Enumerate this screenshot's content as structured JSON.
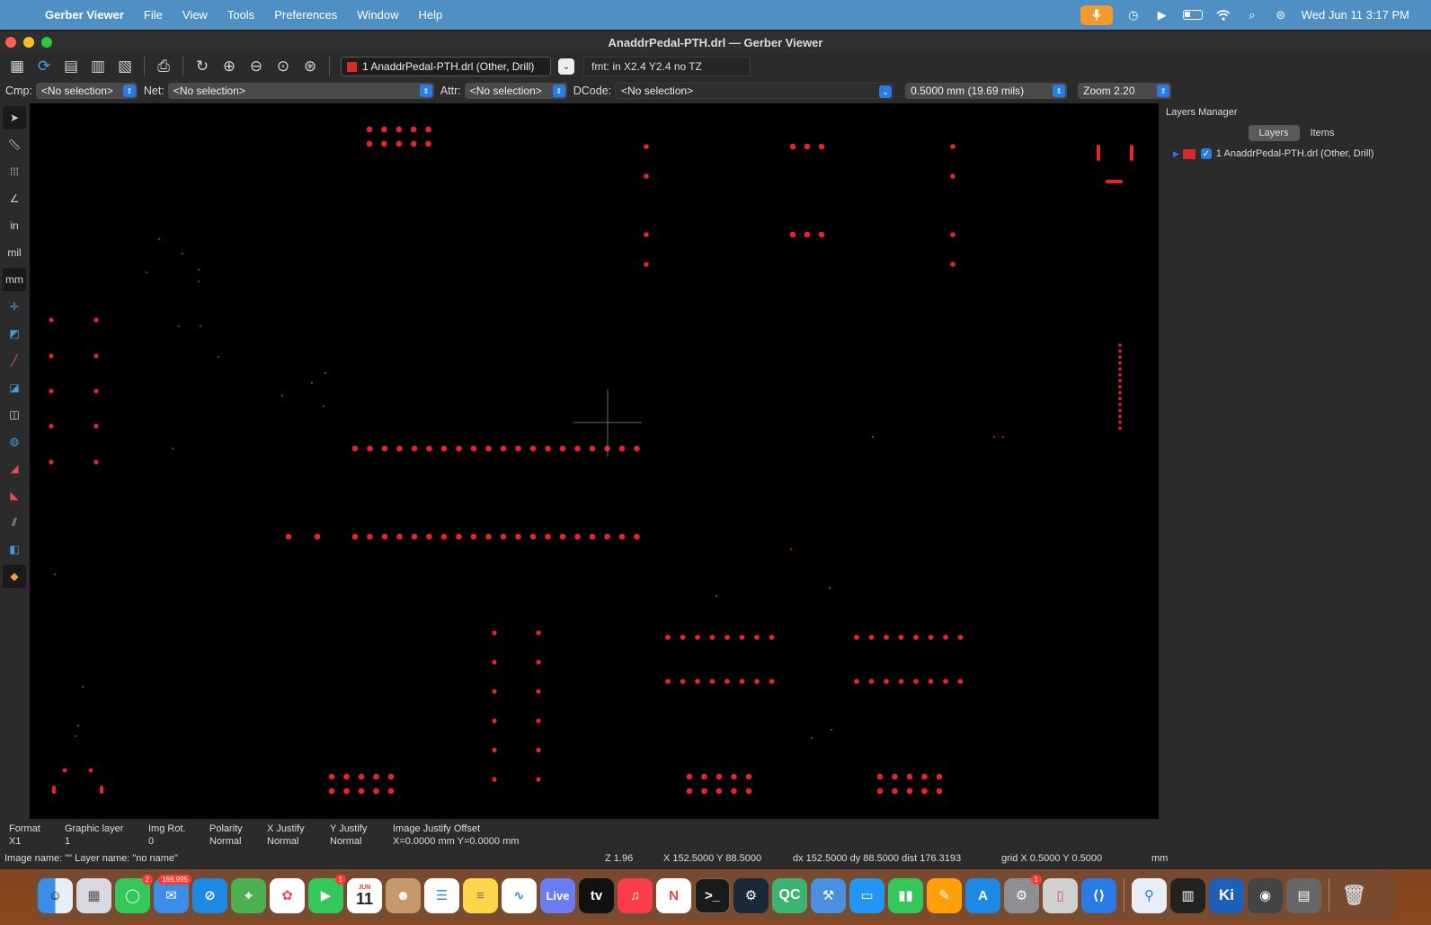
{
  "menubar": {
    "app_name": "Gerber Viewer",
    "items": [
      "File",
      "View",
      "Tools",
      "Preferences",
      "Window",
      "Help"
    ],
    "clock": "Wed Jun 11  3:17 PM"
  },
  "window": {
    "title": "AnaddrPedal-PTH.drl — Gerber Viewer"
  },
  "toolbar": {
    "layer_select": "1 AnaddrPedal-PTH.drl (Other, Drill)",
    "fmt": "fmt: in X2.4 Y2.4 no TZ"
  },
  "selectors": {
    "cmp_label": "Cmp:",
    "cmp_value": "<No selection>",
    "net_label": "Net:",
    "net_value": "<No selection>",
    "attr_label": "Attr:",
    "attr_value": "<No selection>",
    "dcode_label": "DCode:",
    "dcode_value": "<No selection>",
    "grid_value": "0.5000 mm (19.69 mils)",
    "zoom_value": "Zoom 2.20"
  },
  "left_tools": [
    "select",
    "measure",
    "grid",
    "polar",
    "in",
    "mil",
    "mm",
    "cursor",
    "layer-a",
    "layer-b",
    "layer-c",
    "layer-d",
    "layer-e",
    "layer-f",
    "layer-g",
    "layer-h",
    "layer-i",
    "layers"
  ],
  "left_tool_texts": {
    "in": "in",
    "mil": "mil",
    "mm": "mm"
  },
  "layers_manager": {
    "title": "Layers Manager",
    "tabs": [
      "Layers",
      "Items"
    ],
    "active_tab": "Layers",
    "layer_name": "1 AnaddrPedal-PTH.drl (Other, Drill)",
    "layer_color": "#d62b2b"
  },
  "status": {
    "format_label": "Format",
    "format_value": "X1",
    "graphic_layer_label": "Graphic layer",
    "graphic_layer_value": "1",
    "img_rot_label": "Img Rot.",
    "img_rot_value": "0",
    "polarity_label": "Polarity",
    "polarity_value": "Normal",
    "xjustify_label": "X Justify",
    "xjustify_value": "Normal",
    "yjustify_label": "Y Justify",
    "yjustify_value": "Normal",
    "offset_label": "Image Justify Offset",
    "offset_value": "X=0.0000 mm Y=0.0000 mm",
    "image_name": "Image name: \"\"  Layer name: \"no name\"",
    "zoom": "Z 1.96",
    "coords": "X 152.5000  Y 88.5000",
    "delta": "dx 152.5000  dy 88.5000  dist 176.3193",
    "grid": "grid X 0.5000  Y 0.5000",
    "units": "mm"
  },
  "dock": {
    "messages_badge": "2",
    "mail_badge": "169,995",
    "facetime_badge": "1",
    "calendar_month": "JUN",
    "calendar_day": "11",
    "live_label": "Live",
    "qc_label": "QC",
    "ki_label": "Ki",
    "settings_badge": "1"
  },
  "colors": {
    "drill": "#e8232a",
    "menubar": "#4f8fc4",
    "accent": "#2a7be6"
  }
}
